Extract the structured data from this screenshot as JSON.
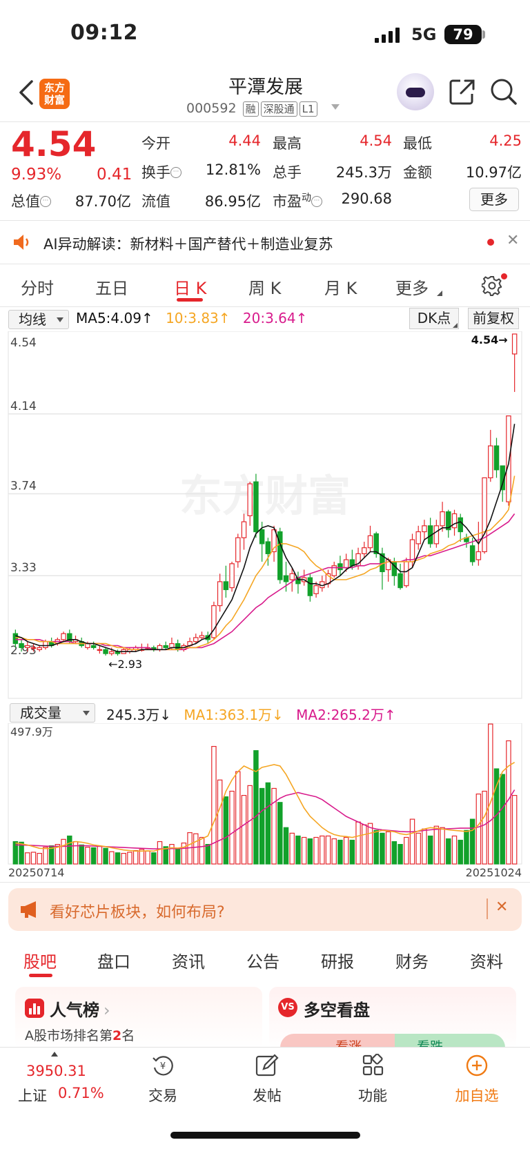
{
  "status_bar": {
    "time": "09:12",
    "network": "5G",
    "battery": "79"
  },
  "header": {
    "name": "平潭发展",
    "code": "000592",
    "tags": [
      "融",
      "深股通",
      "L1"
    ],
    "logo_text": "东方财富"
  },
  "quote": {
    "price": "4.54",
    "change_pct": "9.93%",
    "change_amt": "0.41",
    "fields": [
      {
        "label": "今开",
        "value": "4.44",
        "color": "red"
      },
      {
        "label": "最高",
        "value": "4.54",
        "color": "red"
      },
      {
        "label": "最低",
        "value": "4.25",
        "color": "red"
      },
      {
        "label": "换手",
        "value": "12.81%",
        "color": "black"
      },
      {
        "label": "总手",
        "value": "245.3万",
        "color": "black"
      },
      {
        "label": "金额",
        "value": "10.97亿",
        "color": "black"
      },
      {
        "label": "总值",
        "value": "87.70亿",
        "color": "black"
      },
      {
        "label": "流值",
        "value": "86.95亿",
        "color": "black"
      },
      {
        "label": "市盈",
        "value": "290.68",
        "color": "black"
      }
    ],
    "pe_sup": "动",
    "more_label": "更多"
  },
  "ai_bar": {
    "text": "AI异动解读：新材料＋国产替代＋制造业复苏"
  },
  "period_tabs": [
    "分时",
    "五日",
    "日 K",
    "周 K",
    "月 K",
    "更多"
  ],
  "ma_row": {
    "selector": "均线",
    "ma5": "MA5:4.09",
    "ma10": "10:3.83",
    "ma20": "20:3.64",
    "arrow": "↑",
    "dk_label": "DK点",
    "fq_label": "前复权"
  },
  "vol_row": {
    "selector": "成交量",
    "vol": "245.3万",
    "vol_arrow": "↓",
    "ma1": "MA1:363.1万",
    "ma1_arrow": "↓",
    "ma2": "MA2:265.2万",
    "ma2_arrow": "↑"
  },
  "chart_data": {
    "type": "candlestick",
    "y_ticks": [
      "4.54",
      "4.14",
      "3.74",
      "3.33",
      "2.93"
    ],
    "ylim": [
      2.93,
      4.54
    ],
    "max_label": "4.54→",
    "min_label": "←2.93",
    "vol_max_label": "497.9万",
    "vol_ylim": [
      0,
      497.9
    ],
    "x_start_label": "20250714",
    "x_end_label": "20251024",
    "watermark": "东方财富",
    "colors": {
      "up": "#e5262b",
      "down": "#12a12b",
      "ma5": "#111111",
      "ma10": "#f5a623",
      "ma20": "#d81b8c",
      "vol_ma1": "#f5a623",
      "vol_ma2": "#d81b8c"
    },
    "candles": [
      [
        3.04,
        2.99,
        3.06,
        2.97,
        80
      ],
      [
        2.99,
        2.97,
        3.01,
        2.95,
        78
      ],
      [
        2.97,
        2.98,
        3.0,
        2.95,
        40
      ],
      [
        2.97,
        2.97,
        2.99,
        2.95,
        42
      ],
      [
        2.96,
        2.97,
        2.98,
        2.95,
        38
      ],
      [
        2.97,
        3.0,
        3.01,
        2.96,
        60
      ],
      [
        3.0,
        2.98,
        3.02,
        2.97,
        65
      ],
      [
        2.99,
        3.01,
        3.02,
        2.98,
        70
      ],
      [
        3.01,
        3.04,
        3.05,
        3.0,
        88
      ],
      [
        3.04,
        3.0,
        3.06,
        2.99,
        100
      ],
      [
        3.0,
        3.01,
        3.03,
        2.99,
        80
      ],
      [
        3.0,
        2.98,
        3.02,
        2.97,
        68
      ],
      [
        2.97,
        2.99,
        3.0,
        2.96,
        60
      ],
      [
        2.98,
        2.97,
        3.0,
        2.96,
        58
      ],
      [
        2.96,
        2.96,
        2.98,
        2.94,
        64
      ],
      [
        2.96,
        2.94,
        2.97,
        2.93,
        56
      ],
      [
        2.94,
        2.95,
        2.97,
        2.93,
        44
      ],
      [
        2.95,
        2.94,
        2.96,
        2.93,
        40
      ],
      [
        2.94,
        2.96,
        2.97,
        2.94,
        38
      ],
      [
        2.95,
        2.96,
        2.97,
        2.94,
        42
      ],
      [
        2.96,
        2.97,
        2.98,
        2.95,
        48
      ],
      [
        2.96,
        2.96,
        2.99,
        2.95,
        52
      ],
      [
        2.97,
        2.97,
        2.99,
        2.96,
        46
      ],
      [
        2.97,
        2.96,
        2.98,
        2.95,
        40
      ],
      [
        2.96,
        2.98,
        2.99,
        2.95,
        80
      ],
      [
        2.98,
        2.97,
        3.0,
        2.96,
        62
      ],
      [
        2.97,
        2.99,
        3.02,
        2.96,
        70
      ],
      [
        2.99,
        2.96,
        3.01,
        2.95,
        55
      ],
      [
        2.96,
        2.98,
        2.99,
        2.95,
        75
      ],
      [
        2.98,
        3.0,
        3.02,
        2.97,
        112
      ],
      [
        3.0,
        3.02,
        3.04,
        2.99,
        108
      ],
      [
        3.02,
        3.03,
        3.05,
        3.01,
        95
      ],
      [
        3.03,
        3.01,
        3.05,
        2.99,
        70
      ],
      [
        3.02,
        3.18,
        3.2,
        3.01,
        420
      ],
      [
        3.18,
        3.3,
        3.34,
        3.15,
        300
      ],
      [
        3.3,
        3.26,
        3.38,
        3.22,
        240
      ],
      [
        3.27,
        3.39,
        3.4,
        3.25,
        260
      ],
      [
        3.4,
        3.52,
        3.54,
        3.37,
        330
      ],
      [
        3.52,
        3.6,
        3.64,
        3.46,
        245
      ],
      [
        3.63,
        3.79,
        3.8,
        3.58,
        280
      ],
      [
        3.8,
        3.55,
        3.84,
        3.52,
        405
      ],
      [
        3.56,
        3.49,
        3.6,
        3.4,
        270
      ],
      [
        3.5,
        3.44,
        3.52,
        3.38,
        290
      ],
      [
        3.45,
        3.56,
        3.58,
        3.4,
        270
      ],
      [
        3.55,
        3.31,
        3.57,
        3.29,
        220
      ],
      [
        3.33,
        3.3,
        3.4,
        3.25,
        130
      ],
      [
        3.31,
        3.34,
        3.37,
        3.25,
        110
      ],
      [
        3.32,
        3.29,
        3.35,
        3.24,
        100
      ],
      [
        3.3,
        3.32,
        3.36,
        3.28,
        95
      ],
      [
        3.32,
        3.23,
        3.34,
        3.2,
        90
      ],
      [
        3.24,
        3.28,
        3.3,
        3.22,
        95
      ],
      [
        3.27,
        3.3,
        3.33,
        3.25,
        100
      ],
      [
        3.29,
        3.34,
        3.36,
        3.27,
        100
      ],
      [
        3.33,
        3.38,
        3.4,
        3.32,
        90
      ],
      [
        3.39,
        3.36,
        3.43,
        3.33,
        85
      ],
      [
        3.37,
        3.41,
        3.44,
        3.35,
        95
      ],
      [
        3.41,
        3.38,
        3.46,
        3.36,
        85
      ],
      [
        3.38,
        3.44,
        3.47,
        3.36,
        150
      ],
      [
        3.44,
        3.47,
        3.5,
        3.42,
        140
      ],
      [
        3.47,
        3.53,
        3.58,
        3.45,
        145
      ],
      [
        3.54,
        3.44,
        3.55,
        3.42,
        120
      ],
      [
        3.44,
        3.35,
        3.47,
        3.26,
        110
      ],
      [
        3.36,
        3.41,
        3.42,
        3.3,
        115
      ],
      [
        3.4,
        3.33,
        3.42,
        3.28,
        80
      ],
      [
        3.34,
        3.27,
        3.39,
        3.26,
        70
      ],
      [
        3.28,
        3.4,
        3.42,
        3.27,
        95
      ],
      [
        3.4,
        3.51,
        3.54,
        3.37,
        160
      ],
      [
        3.49,
        3.55,
        3.58,
        3.46,
        110
      ],
      [
        3.55,
        3.58,
        3.61,
        3.51,
        125
      ],
      [
        3.58,
        3.49,
        3.62,
        3.47,
        100
      ],
      [
        3.49,
        3.58,
        3.61,
        3.47,
        135
      ],
      [
        3.58,
        3.65,
        3.7,
        3.55,
        130
      ],
      [
        3.65,
        3.56,
        3.66,
        3.52,
        90
      ],
      [
        3.57,
        3.64,
        3.66,
        3.53,
        100
      ],
      [
        3.62,
        3.55,
        3.64,
        3.5,
        85
      ],
      [
        3.52,
        3.5,
        3.54,
        3.47,
        120
      ],
      [
        3.48,
        3.4,
        3.52,
        3.38,
        160
      ],
      [
        3.41,
        3.45,
        3.6,
        3.38,
        250
      ],
      [
        3.45,
        3.82,
        3.82,
        3.44,
        260
      ],
      [
        3.82,
        3.98,
        4.06,
        3.8,
        500
      ],
      [
        3.98,
        3.86,
        4.02,
        3.82,
        340
      ],
      [
        3.88,
        3.76,
        3.88,
        3.7,
        320
      ],
      [
        3.7,
        4.13,
        4.13,
        3.68,
        440
      ],
      [
        4.44,
        4.54,
        4.54,
        4.25,
        245
      ]
    ],
    "ma5": [
      3.03,
      3.02,
      3.0,
      2.99,
      2.98,
      2.98,
      2.98,
      2.99,
      3.0,
      3.01,
      3.01,
      3.0,
      2.99,
      2.99,
      2.98,
      2.97,
      2.96,
      2.95,
      2.95,
      2.95,
      2.95,
      2.96,
      2.96,
      2.96,
      2.96,
      2.96,
      2.97,
      2.97,
      2.97,
      2.98,
      2.99,
      3.01,
      3.02,
      3.06,
      3.11,
      3.16,
      3.21,
      3.29,
      3.37,
      3.47,
      3.54,
      3.57,
      3.58,
      3.57,
      3.49,
      3.42,
      3.37,
      3.31,
      3.31,
      3.29,
      3.29,
      3.28,
      3.29,
      3.31,
      3.33,
      3.36,
      3.38,
      3.39,
      3.42,
      3.45,
      3.45,
      3.43,
      3.41,
      3.38,
      3.35,
      3.35,
      3.37,
      3.44,
      3.51,
      3.53,
      3.55,
      3.57,
      3.57,
      3.59,
      3.6,
      3.57,
      3.53,
      3.49,
      3.54,
      3.61,
      3.7,
      3.79,
      3.89,
      4.09
    ],
    "ma10": [
      3.02,
      3.02,
      3.01,
      3.01,
      3.0,
      3.0,
      3.0,
      2.99,
      2.99,
      2.99,
      2.99,
      2.99,
      2.99,
      2.99,
      2.99,
      2.99,
      2.98,
      2.97,
      2.97,
      2.96,
      2.96,
      2.96,
      2.96,
      2.96,
      2.96,
      2.96,
      2.96,
      2.96,
      2.97,
      2.97,
      2.97,
      2.98,
      2.99,
      3.01,
      3.04,
      3.08,
      3.11,
      3.16,
      3.21,
      3.27,
      3.33,
      3.37,
      3.42,
      3.47,
      3.49,
      3.49,
      3.48,
      3.47,
      3.45,
      3.41,
      3.38,
      3.36,
      3.33,
      3.31,
      3.31,
      3.31,
      3.32,
      3.33,
      3.34,
      3.36,
      3.37,
      3.39,
      3.4,
      3.4,
      3.4,
      3.4,
      3.4,
      3.41,
      3.42,
      3.44,
      3.45,
      3.46,
      3.48,
      3.49,
      3.51,
      3.52,
      3.53,
      3.54,
      3.55,
      3.56,
      3.59,
      3.62,
      3.66,
      3.83
    ],
    "ma20": [
      3.01,
      3.01,
      3.01,
      3.01,
      3.01,
      3.0,
      3.0,
      3.0,
      3.0,
      3.0,
      2.99,
      2.99,
      2.99,
      2.99,
      2.99,
      2.98,
      2.98,
      2.98,
      2.97,
      2.97,
      2.97,
      2.97,
      2.97,
      2.96,
      2.96,
      2.96,
      2.96,
      2.96,
      2.96,
      2.97,
      2.97,
      2.97,
      2.98,
      2.99,
      3.01,
      3.03,
      3.05,
      3.08,
      3.11,
      3.14,
      3.17,
      3.19,
      3.22,
      3.24,
      3.26,
      3.28,
      3.3,
      3.32,
      3.33,
      3.34,
      3.35,
      3.36,
      3.37,
      3.37,
      3.37,
      3.37,
      3.37,
      3.38,
      3.38,
      3.39,
      3.39,
      3.39,
      3.4,
      3.4,
      3.4,
      3.41,
      3.41,
      3.42,
      3.43,
      3.43,
      3.44,
      3.45,
      3.46,
      3.47,
      3.48,
      3.49,
      3.5,
      3.51,
      3.52,
      3.54,
      3.56,
      3.58,
      3.6,
      3.64
    ],
    "vol_ma1": [
      75,
      72,
      68,
      62,
      56,
      55,
      56,
      60,
      66,
      75,
      80,
      78,
      74,
      68,
      65,
      62,
      58,
      54,
      50,
      48,
      46,
      46,
      47,
      46,
      52,
      55,
      58,
      57,
      60,
      70,
      80,
      90,
      100,
      150,
      200,
      260,
      300,
      330,
      350,
      340,
      330,
      345,
      350,
      355,
      350,
      320,
      280,
      240,
      200,
      170,
      150,
      130,
      115,
      105,
      100,
      98,
      95,
      100,
      105,
      110,
      115,
      120,
      118,
      115,
      108,
      105,
      110,
      118,
      125,
      130,
      128,
      125,
      122,
      120,
      118,
      116,
      120,
      140,
      170,
      220,
      280,
      330,
      350,
      363
    ],
    "vol_ma2": [
      68,
      68,
      67,
      66,
      65,
      64,
      63,
      63,
      63,
      64,
      65,
      65,
      65,
      64,
      63,
      62,
      61,
      60,
      59,
      58,
      57,
      56,
      55,
      54,
      54,
      54,
      55,
      55,
      56,
      58,
      60,
      62,
      65,
      75,
      85,
      95,
      110,
      125,
      140,
      155,
      170,
      190,
      205,
      220,
      235,
      245,
      250,
      255,
      250,
      245,
      240,
      230,
      215,
      200,
      185,
      170,
      160,
      150,
      140,
      130,
      125,
      122,
      120,
      118,
      116,
      115,
      115,
      117,
      120,
      122,
      124,
      125,
      126,
      127,
      128,
      128,
      128,
      132,
      140,
      155,
      175,
      200,
      230,
      265
    ]
  },
  "banner": {
    "text": "看好芯片板块，如何布局?"
  },
  "bottom_tabs": [
    "股吧",
    "盘口",
    "资讯",
    "公告",
    "研报",
    "财务",
    "资料"
  ],
  "cards": {
    "rank_title": "人气榜",
    "rank_sub_pre": "A股市场排名第",
    "rank_num": "2",
    "rank_sub_post": "名",
    "dk_title": "多空看盘",
    "vs_icon": "VS",
    "up_label": "看涨",
    "down_label": "看跌"
  },
  "bottom_nav": {
    "index_value": "3950.31",
    "index_name": "上证",
    "index_pct": "0.71%",
    "items": [
      "交易",
      "发帖",
      "功能",
      "加自选"
    ]
  }
}
